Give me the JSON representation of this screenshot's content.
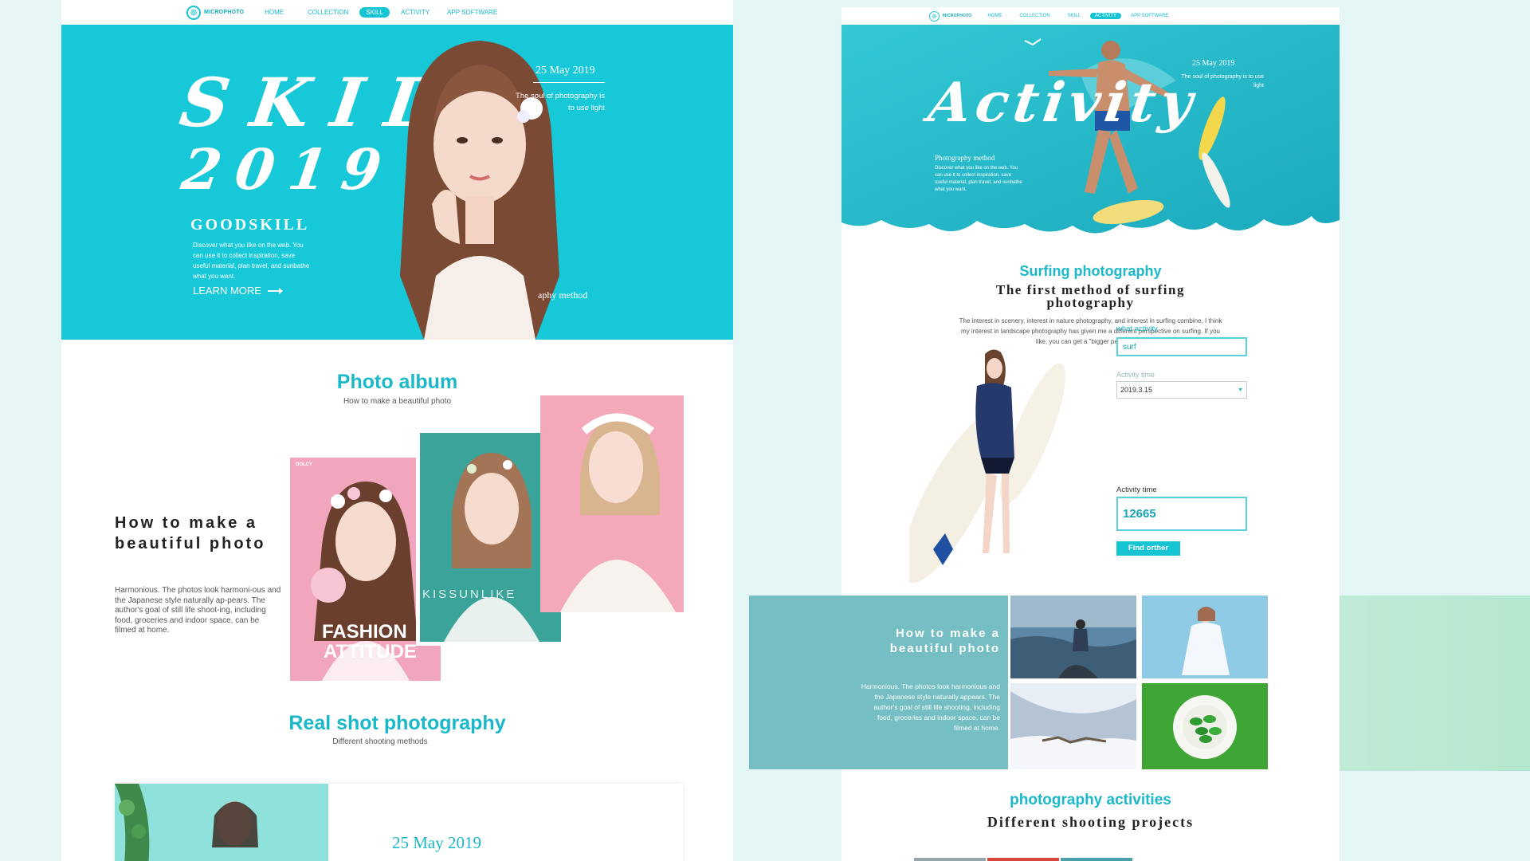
{
  "left_page": {
    "nav": {
      "logo": "MICROPHOTO",
      "items": [
        "HOME",
        "COLLECTION",
        "SKILL",
        "ACTIVITY",
        "APP SOFTWARE"
      ],
      "active": "SKILL"
    },
    "hero": {
      "word": "SKIL",
      "year": "2019",
      "date": "25 May 2019",
      "soul_text": "The soul of photography is to use light",
      "headline": "GOODSKILL",
      "description": "Discover what you like on the web. You can use it to collect inspiration, save useful material, plan travel, and sunbathe what you want.",
      "learn_more": "LEARN MORE",
      "method_text": "aphy method"
    },
    "album": {
      "title": "Photo album",
      "subtitle": "How to make a beautiful photo",
      "howto_title": "How to make a beautiful photo",
      "howto_desc": "Harmonious. The photos look harmoni-ous and the Japanese style naturally ap-pears. The author's goal of still life shoot-ing, including food, groceries and indoor space, can be filmed at home.",
      "card1_tag": "DOLCY",
      "card1_text1": "FASHION",
      "card1_text2": "ATTITUDE",
      "card2_text": "KISSUNLIKE"
    },
    "real_shot": {
      "title": "Real shot photography",
      "subtitle": "Different shooting methods",
      "date": "25 May 2019"
    }
  },
  "right_page": {
    "nav": {
      "logo": "MICROPHOTO",
      "items": [
        "HOME",
        "COLLECTION",
        "SKILL",
        "ACTIVITY",
        "APP SOFTWARE"
      ],
      "active": "ACTIVITY"
    },
    "hero": {
      "word": "Activity",
      "date": "25 May 2019",
      "soul_text": "The soul of photography is to use light",
      "method_title": "Photography method",
      "method_desc": "Discover what you like on the web. You can use it to collect inspiration, save useful material, plan travel, and sunbathe what you want."
    },
    "surfing": {
      "title": "Surfing photography",
      "headline": "The first method of surfing photography",
      "description": "The interest in scenery, interest in nature photography, and interest in surfing combine. I think my interest in landscape photography has given me a different perspective on surfing. If you like, you can get a \"bigger perspective."
    },
    "form": {
      "what_label": "what activity",
      "what_value": "surf",
      "time_label": "Activity time",
      "time_value": "2019.3.15",
      "count_label": "Activity time",
      "count_value": "12665",
      "button": "Find orther"
    },
    "gallery": {
      "title": "How to make a beautiful photo",
      "description": "Harmonious. The photos look harmonious and the Japanese style naturally appears. The author's goal of still life shooting, including food, groceries and indoor space, can be filmed at home."
    },
    "activities": {
      "title": "photography activities",
      "subtitle": "Different shooting projects"
    }
  },
  "colors": {
    "accent": "#17c9d8",
    "accent_text": "#1ab8c8",
    "teal_panel": "#75bfc4",
    "mint": "#c5ecd9"
  }
}
